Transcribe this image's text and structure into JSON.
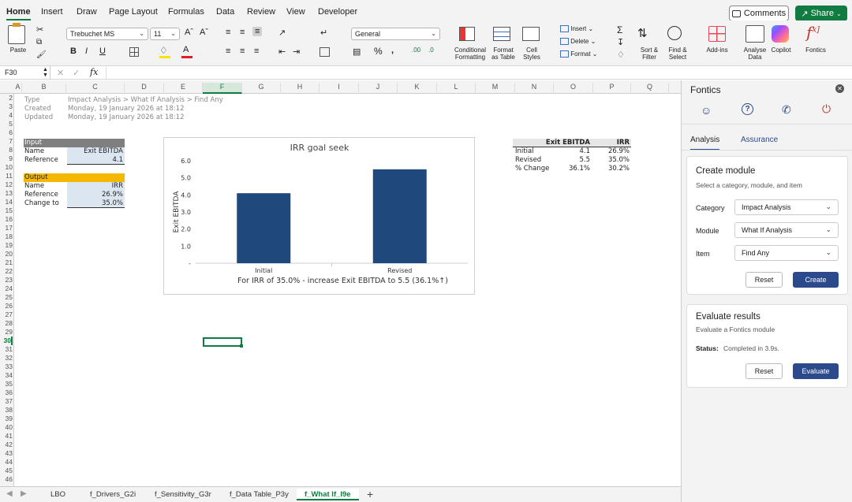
{
  "ribbon_tabs": [
    "Home",
    "Insert",
    "Draw",
    "Page Layout",
    "Formulas",
    "Data",
    "Review",
    "View",
    "Developer"
  ],
  "comments": "Comments",
  "share": "Share",
  "ribbon": {
    "paste": "Paste",
    "font_name": "Trebuchet MS",
    "font_size": "11",
    "number_format": "General",
    "cond_fmt": [
      "Conditional",
      "Formatting"
    ],
    "fmt_table": [
      "Format",
      "as Table"
    ],
    "cell_styles": [
      "Cell",
      "Styles"
    ],
    "insert": "Insert",
    "delete": "Delete",
    "format": "Format",
    "sort": [
      "Sort &",
      "Filter"
    ],
    "find": [
      "Find &",
      "Select"
    ],
    "addins": "Add-ins",
    "analyse": [
      "Analyse",
      "Data"
    ],
    "copilot": "Copilot",
    "fontics": "Fontics"
  },
  "name_box": "F30",
  "fx": "fx",
  "columns": [
    "A",
    "B",
    "C",
    "D",
    "E",
    "F",
    "G",
    "H",
    "I",
    "J",
    "K",
    "L",
    "M",
    "N",
    "O",
    "P",
    "Q"
  ],
  "rows": [
    "2",
    "3",
    "4",
    "5",
    "6",
    "7",
    "8",
    "9",
    "10",
    "11",
    "12",
    "13",
    "14",
    "15",
    "16",
    "17",
    "18",
    "19",
    "20",
    "21",
    "22",
    "23",
    "24",
    "25",
    "26",
    "27",
    "28",
    "29",
    "30",
    "31",
    "32",
    "33",
    "34",
    "35",
    "36",
    "37",
    "38",
    "39",
    "40",
    "41",
    "42",
    "43",
    "44",
    "45",
    "46"
  ],
  "meta": {
    "type_label": "Type",
    "type_value": "Impact Analysis > What If Analysis > Find Any",
    "created_label": "Created",
    "created_value": "Monday, 19 January 2026 at 18:12",
    "updated_label": "Updated",
    "updated_value": "Monday, 19 January 2026 at 18:12"
  },
  "input": {
    "header": "Input",
    "name_label": "Name",
    "name_value": "Exit EBITDA",
    "ref_label": "Reference",
    "ref_value": "4.1"
  },
  "output": {
    "header": "Output",
    "name_label": "Name",
    "name_value": "IRR",
    "ref_label": "Reference",
    "ref_value": "26.9%",
    "change_label": "Change to",
    "change_value": "35.0%"
  },
  "summary": {
    "col1": "Exit EBITDA",
    "col2": "IRR",
    "rows": [
      {
        "label": "Initial",
        "v1": "4.1",
        "v2": "26.9%"
      },
      {
        "label": "Revised",
        "v1": "5.5",
        "v2": "35.0%"
      },
      {
        "label": "% Change",
        "v1": "36.1%",
        "v2": "30.2%"
      }
    ]
  },
  "chart_data": {
    "type": "bar",
    "title": "IRR goal seek",
    "categories": [
      "Initial",
      "Revised"
    ],
    "values": [
      4.1,
      5.5
    ],
    "ylabel": "Exit EBITDA",
    "xlabel": "For IRR of 35.0% - increase Exit EBITDA to 5.5 (36.1%↑)",
    "yticks": [
      "6.0",
      "5.0",
      "4.0",
      "3.0",
      "2.0",
      "1.0",
      "-"
    ],
    "ylim": [
      0,
      6
    ],
    "color": "#1f497d"
  },
  "sheet_tabs": [
    "LBO",
    "f_Drivers_G2i",
    "f_Sensitivity_G3r",
    "f_Data Table_P3y",
    "f_What If_I9e"
  ],
  "panel": {
    "title": "Fontics",
    "tabs": [
      "Analysis",
      "Assurance"
    ],
    "create": {
      "title": "Create module",
      "subtitle": "Select a category, module, and item",
      "category_label": "Category",
      "category_value": "Impact Analysis",
      "module_label": "Module",
      "module_value": "What If Analysis",
      "item_label": "Item",
      "item_value": "Find Any",
      "reset": "Reset",
      "create": "Create"
    },
    "evaluate": {
      "title": "Evaluate results",
      "subtitle": "Evaluate a Fontics module",
      "status_label": "Status:",
      "status_value": "Completed in 3.9s.",
      "reset": "Reset",
      "evaluate": "Evaluate"
    }
  },
  "colors": {
    "accent": "#107c41",
    "bar": "#1f497d",
    "panel_primary": "#2b4a8b",
    "input_header": "#7f7f7f",
    "output_header": "#f5b800",
    "input_fill": "#dce6f1"
  }
}
